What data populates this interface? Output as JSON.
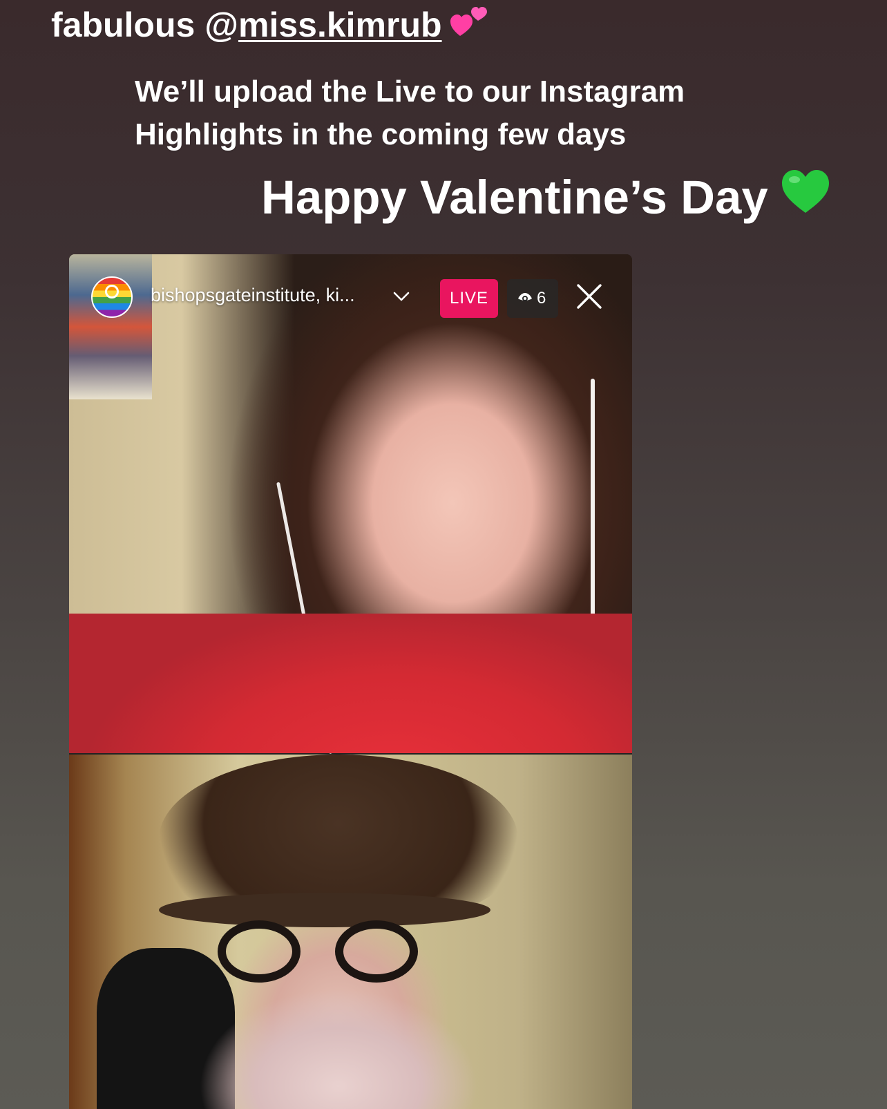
{
  "story": {
    "line1_prefix": "fabulous @",
    "line1_mention": "miss.kimrub",
    "line1_emoji_icon": "two-hearts-icon",
    "line2": "We’ll upload the Live to our Instagram Highlights in the coming few days",
    "line3": "Happy Valentine’s Day",
    "line3_emoji_icon": "green-heart-icon"
  },
  "live": {
    "host_name": "bishopsgateinstitute, ki...",
    "badge": "LIVE",
    "viewers": "6",
    "icons": {
      "dropdown": "chevron-down-icon",
      "viewers": "eye-icon",
      "close": "close-icon"
    }
  },
  "colors": {
    "live_badge": "#e9155f",
    "green_heart": "#27c93f",
    "pink_heart": "#ff3fa4"
  }
}
